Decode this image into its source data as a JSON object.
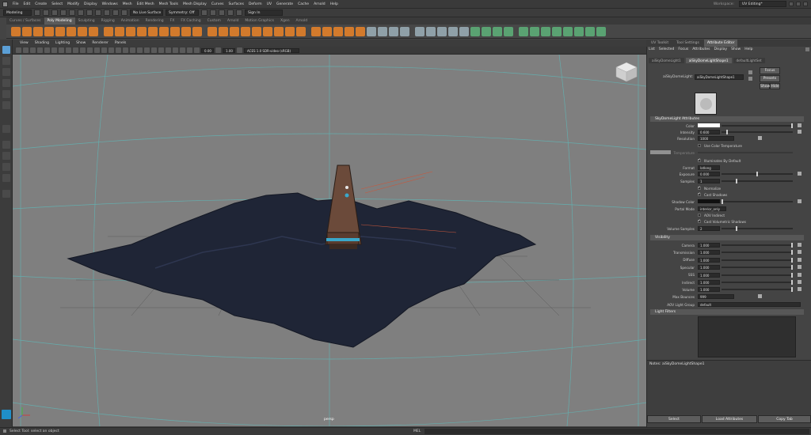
{
  "menubar": {
    "items": [
      "File",
      "Edit",
      "Create",
      "Select",
      "Modify",
      "Display",
      "Windows",
      "Mesh",
      "Edit Mesh",
      "Mesh Tools",
      "Mesh Display",
      "Curves",
      "Surfaces",
      "Deform",
      "UV",
      "Generate",
      "Cache",
      "Arnold",
      "Help"
    ],
    "workspace_label": "Workspace:",
    "workspace_value": "UV Editing*"
  },
  "statusline": {
    "mode": "Modeling",
    "live_surface": "No Live Surface",
    "symmetry": "Symmetry: Off",
    "signin": "Sign In"
  },
  "shelf_tabs": [
    "Curves / Surfaces",
    "Poly Modeling",
    "Sculpting",
    "Rigging",
    "Animation",
    "Rendering",
    "FX",
    "FX Caching",
    "Custom",
    "Arnold",
    "Motion Graphics",
    "Xgen",
    "Arnold"
  ],
  "shelf_active": "Poly Modeling",
  "viewport": {
    "menu": [
      "View",
      "Shading",
      "Lighting",
      "Show",
      "Renderer",
      "Panels"
    ],
    "exposure": "0.00",
    "gamma": "1.00",
    "colorspace": "ACES 1.0 SDR-video (sRGB)",
    "camera_label": "persp"
  },
  "panel_tabs": [
    "UV Toolkit",
    "Tool Settings",
    "Attribute Editor"
  ],
  "panel_active": "Attribute Editor",
  "ae": {
    "menu": [
      "List",
      "Selected",
      "Focus",
      "Attributes",
      "Display",
      "Show",
      "Help"
    ],
    "node_tabs": [
      "aiSkyDomeLight1",
      "aiSkyDomeLightShape1",
      "defaultLightSet"
    ],
    "node_label": "aiSkyDomeLight:",
    "node_value": "aiSkyDomeLightShape1",
    "focus_btn": "Focus",
    "presets_btn": "Presets",
    "show_btn": "Show",
    "hide_btn": "Hide",
    "section1": "SkyDomeLight Attributes",
    "color_label": "Color",
    "intensity_label": "Intensity",
    "intensity_value": "0.600",
    "resolution_label": "Resolution",
    "resolution_value": "1000",
    "use_color_temp": "Use Color Temperature",
    "temperature_label": "Temperature",
    "illuminates": "Illuminates By Default",
    "format_label": "Format",
    "format_value": "latlong",
    "exposure_label": "Exposure",
    "exposure_value": "0.000",
    "samples_label": "Samples",
    "samples_value": "1",
    "normalize": "Normalize",
    "cast_shadows": "Cast Shadows",
    "shadow_color_label": "Shadow Color",
    "portal_mode_label": "Portal Mode",
    "portal_mode_value": "interior_only",
    "aov_indirect": "AOV Indirect",
    "cast_vol_shadows": "Cast Volumetric Shadows",
    "vol_samples_label": "Volume Samples",
    "vol_samples_value": "2",
    "section2": "Visibility",
    "vis": [
      {
        "label": "Camera",
        "value": "1.000"
      },
      {
        "label": "Transmission",
        "value": "1.000"
      },
      {
        "label": "Diffuse",
        "value": "1.000"
      },
      {
        "label": "Specular",
        "value": "1.000"
      },
      {
        "label": "SSS",
        "value": "1.000"
      },
      {
        "label": "Indirect",
        "value": "1.000"
      },
      {
        "label": "Volume",
        "value": "1.000"
      }
    ],
    "max_bounces_label": "Max Bounces",
    "max_bounces_value": "999",
    "aov_group_label": "AOV Light Group",
    "aov_group_value": "default",
    "section3": "Light Filters",
    "notes_label": "Notes: aiSkyDomeLightShape1",
    "select_btn": "Select",
    "load_btn": "Load Attributes",
    "copy_btn": "Copy Tab"
  },
  "bottom": {
    "help": "Select Tool: select an object",
    "mel": "MEL"
  },
  "colors": {
    "accent": "#5b9fd6",
    "shelf_orange": "#d27a2c",
    "viewport_bg": "#7f7f7f",
    "terrain": "#1f2536"
  }
}
